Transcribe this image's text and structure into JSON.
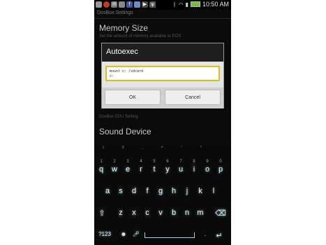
{
  "status_bar": {
    "time": "10:50 AM",
    "left_icons": [
      "app-notification-icon",
      "record-icon",
      "mail-icon",
      "calendar-icon",
      "facebook-icon",
      "gallery-icon",
      "play-icon",
      "usb-icon"
    ]
  },
  "app": {
    "header": "DosBox Settings",
    "settings": [
      {
        "title": "Memory Size",
        "subtitle": "Set the amount of memory available to DOS"
      },
      {
        "title": "",
        "subtitle": "DosBox CPU Setting"
      },
      {
        "title": "Sound Device",
        "subtitle": ""
      }
    ]
  },
  "dialog": {
    "title": "Autoexec",
    "field_value": "mount c: /sdcard\nc:",
    "ok_label": "OK",
    "cancel_label": "Cancel"
  },
  "keyboard": {
    "number_hints": [
      "1",
      "2",
      "3",
      "4",
      "5",
      "6",
      "7",
      "8",
      "9",
      "0"
    ],
    "row1": [
      "q",
      "w",
      "e",
      "r",
      "t",
      "y",
      "u",
      "i",
      "o",
      "p"
    ],
    "row2": [
      "a",
      "s",
      "d",
      "f",
      "g",
      "h",
      "j",
      "k",
      "l"
    ],
    "row3": [
      "z",
      "x",
      "c",
      "v",
      "b",
      "n",
      "m"
    ],
    "symbols_label": "?123",
    "symbol_row": [
      "!",
      "?",
      ".",
      "*",
      "'",
      "\""
    ],
    "special_keys": [
      "shift-icon",
      "backspace-icon",
      "emoji-icon",
      "mic-icon",
      "enter-icon"
    ]
  }
}
